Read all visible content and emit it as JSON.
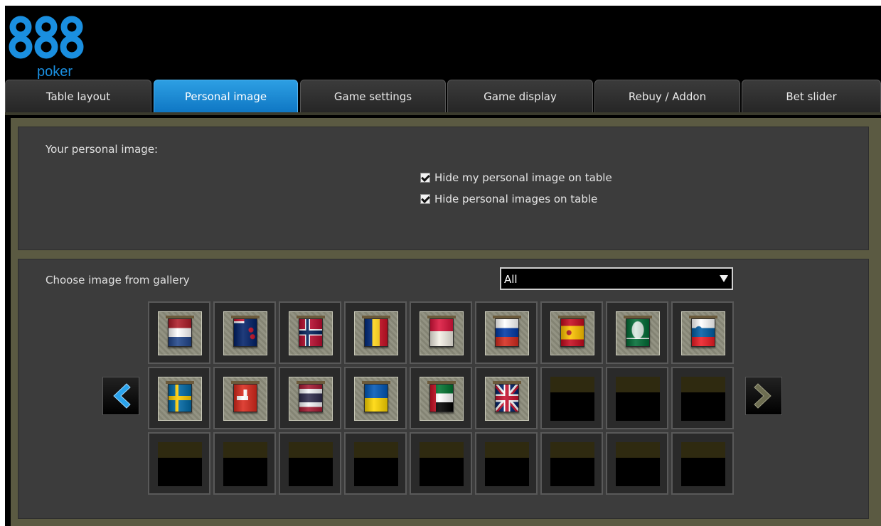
{
  "logo": {
    "digits": "888",
    "subtitle": "poker"
  },
  "tabs": [
    {
      "label": "Table layout",
      "active": false
    },
    {
      "label": "Personal image",
      "active": true
    },
    {
      "label": "Game settings",
      "active": false
    },
    {
      "label": "Game display",
      "active": false
    },
    {
      "label": "Rebuy / Addon",
      "active": false
    },
    {
      "label": "Bet slider",
      "active": false
    }
  ],
  "personal": {
    "heading": "Your personal image:",
    "options": [
      {
        "label": "Hide my personal image on table",
        "checked": true
      },
      {
        "label": "Hide personal images on table",
        "checked": true
      }
    ]
  },
  "gallery": {
    "heading": "Choose image from gallery",
    "filter_value": "All",
    "items": [
      "netherlands-flag",
      "new-zealand-flag",
      "norway-flag",
      "romania-flag",
      "poland-flag",
      "russia-flag",
      "spain-flag",
      "saudi-arabia-flag",
      "slovenia-flag",
      "sweden-flag",
      "switzerland-flag",
      "thailand-flag",
      "ukraine-flag",
      "uae-flag",
      "uk-flag",
      "empty",
      "empty",
      "empty",
      "empty",
      "empty",
      "empty",
      "empty",
      "empty",
      "empty",
      "empty",
      "empty",
      "empty"
    ]
  },
  "colors": {
    "accent": "#1a8fe0",
    "tab_active": "#1480cf",
    "panel": "#3c3c3c",
    "frame": "#5b5a42"
  }
}
